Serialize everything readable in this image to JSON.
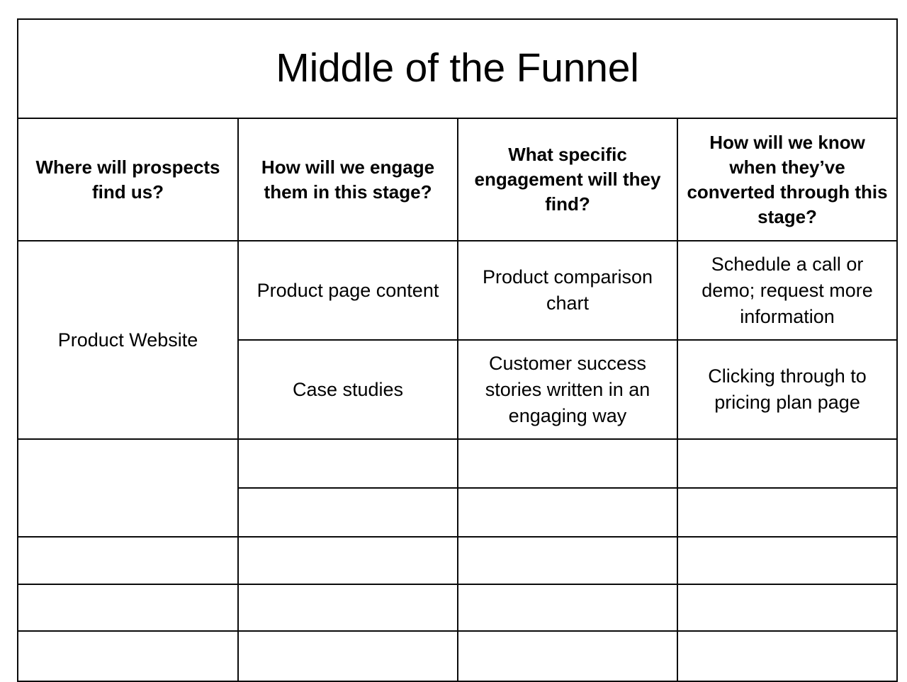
{
  "document": {
    "title": "Middle of the Funnel"
  },
  "table": {
    "columns": [
      {
        "id": "where-find-us",
        "header": "Where will prospects find us?"
      },
      {
        "id": "how-engage",
        "header": "How will we engage them in this stage?"
      },
      {
        "id": "what-engagement",
        "header": "What specific engagement will they find?"
      },
      {
        "id": "how-know-converted",
        "header": "How will we know when they’ve converted through this stage?"
      }
    ],
    "groups": [
      {
        "channel": "Product Website",
        "rows": [
          {
            "engagement": "Product page content",
            "specific": "Product comparison chart",
            "conversion": "Schedule a call or demo; request more information"
          },
          {
            "engagement": "Case studies",
            "specific": "Customer success stories written in an engaging way",
            "conversion": "Clicking through to pricing plan page"
          }
        ]
      },
      {
        "channel": "",
        "rows": [
          {
            "engagement": "",
            "specific": "",
            "conversion": ""
          },
          {
            "engagement": "",
            "specific": "",
            "conversion": ""
          }
        ]
      }
    ],
    "empty_rows": [
      {
        "channel": "",
        "engagement": "",
        "specific": "",
        "conversion": ""
      },
      {
        "channel": "",
        "engagement": "",
        "specific": "",
        "conversion": ""
      },
      {
        "channel": "",
        "engagement": "",
        "specific": "",
        "conversion": ""
      }
    ]
  },
  "style": {
    "border_color": "#0a0a0a",
    "text_color": "#000000",
    "background": "#ffffff"
  }
}
